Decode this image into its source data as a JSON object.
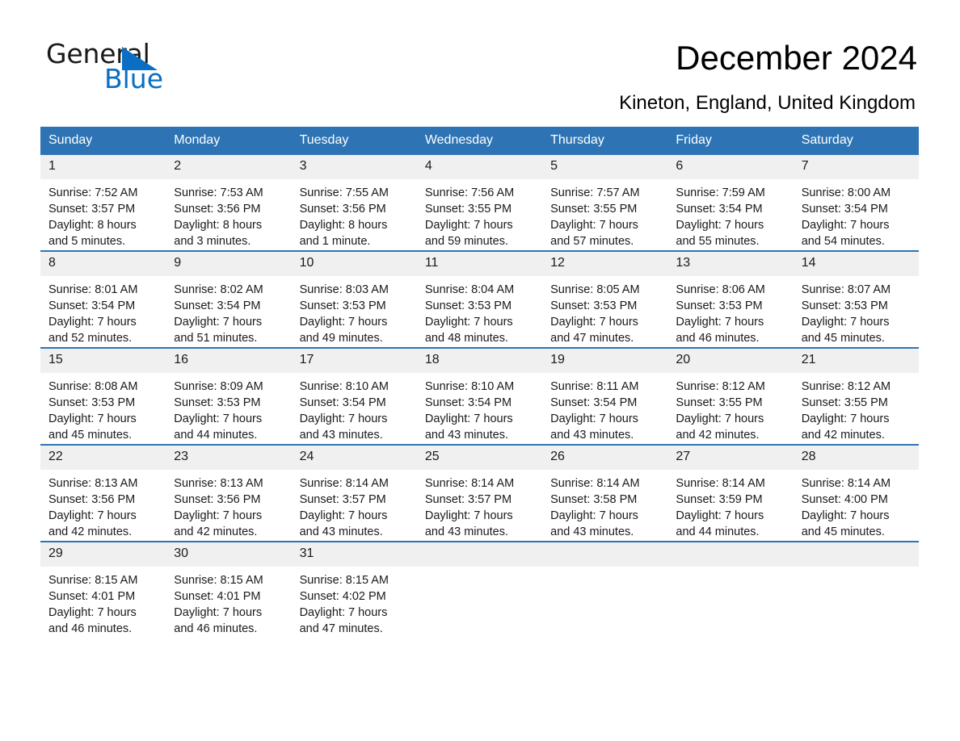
{
  "logo": {
    "word_one": "General",
    "word_two": "Blue",
    "triangle_color": "#0A6FC2",
    "text_color": "#1a1a1a"
  },
  "header": {
    "title": "December 2024",
    "location": "Kineton, England, United Kingdom"
  },
  "theme": {
    "header_blue": "#2E74B5",
    "row_band": "#F0F0F0",
    "text": "#1a1a1a"
  },
  "weekday_headers": [
    "Sunday",
    "Monday",
    "Tuesday",
    "Wednesday",
    "Thursday",
    "Friday",
    "Saturday"
  ],
  "weeks": [
    [
      {
        "day": "1",
        "sunrise": "Sunrise: 7:52 AM",
        "sunset": "Sunset: 3:57 PM",
        "daylight_line1": "Daylight: 8 hours",
        "daylight_line2": "and 5 minutes."
      },
      {
        "day": "2",
        "sunrise": "Sunrise: 7:53 AM",
        "sunset": "Sunset: 3:56 PM",
        "daylight_line1": "Daylight: 8 hours",
        "daylight_line2": "and 3 minutes."
      },
      {
        "day": "3",
        "sunrise": "Sunrise: 7:55 AM",
        "sunset": "Sunset: 3:56 PM",
        "daylight_line1": "Daylight: 8 hours",
        "daylight_line2": "and 1 minute."
      },
      {
        "day": "4",
        "sunrise": "Sunrise: 7:56 AM",
        "sunset": "Sunset: 3:55 PM",
        "daylight_line1": "Daylight: 7 hours",
        "daylight_line2": "and 59 minutes."
      },
      {
        "day": "5",
        "sunrise": "Sunrise: 7:57 AM",
        "sunset": "Sunset: 3:55 PM",
        "daylight_line1": "Daylight: 7 hours",
        "daylight_line2": "and 57 minutes."
      },
      {
        "day": "6",
        "sunrise": "Sunrise: 7:59 AM",
        "sunset": "Sunset: 3:54 PM",
        "daylight_line1": "Daylight: 7 hours",
        "daylight_line2": "and 55 minutes."
      },
      {
        "day": "7",
        "sunrise": "Sunrise: 8:00 AM",
        "sunset": "Sunset: 3:54 PM",
        "daylight_line1": "Daylight: 7 hours",
        "daylight_line2": "and 54 minutes."
      }
    ],
    [
      {
        "day": "8",
        "sunrise": "Sunrise: 8:01 AM",
        "sunset": "Sunset: 3:54 PM",
        "daylight_line1": "Daylight: 7 hours",
        "daylight_line2": "and 52 minutes."
      },
      {
        "day": "9",
        "sunrise": "Sunrise: 8:02 AM",
        "sunset": "Sunset: 3:54 PM",
        "daylight_line1": "Daylight: 7 hours",
        "daylight_line2": "and 51 minutes."
      },
      {
        "day": "10",
        "sunrise": "Sunrise: 8:03 AM",
        "sunset": "Sunset: 3:53 PM",
        "daylight_line1": "Daylight: 7 hours",
        "daylight_line2": "and 49 minutes."
      },
      {
        "day": "11",
        "sunrise": "Sunrise: 8:04 AM",
        "sunset": "Sunset: 3:53 PM",
        "daylight_line1": "Daylight: 7 hours",
        "daylight_line2": "and 48 minutes."
      },
      {
        "day": "12",
        "sunrise": "Sunrise: 8:05 AM",
        "sunset": "Sunset: 3:53 PM",
        "daylight_line1": "Daylight: 7 hours",
        "daylight_line2": "and 47 minutes."
      },
      {
        "day": "13",
        "sunrise": "Sunrise: 8:06 AM",
        "sunset": "Sunset: 3:53 PM",
        "daylight_line1": "Daylight: 7 hours",
        "daylight_line2": "and 46 minutes."
      },
      {
        "day": "14",
        "sunrise": "Sunrise: 8:07 AM",
        "sunset": "Sunset: 3:53 PM",
        "daylight_line1": "Daylight: 7 hours",
        "daylight_line2": "and 45 minutes."
      }
    ],
    [
      {
        "day": "15",
        "sunrise": "Sunrise: 8:08 AM",
        "sunset": "Sunset: 3:53 PM",
        "daylight_line1": "Daylight: 7 hours",
        "daylight_line2": "and 45 minutes."
      },
      {
        "day": "16",
        "sunrise": "Sunrise: 8:09 AM",
        "sunset": "Sunset: 3:53 PM",
        "daylight_line1": "Daylight: 7 hours",
        "daylight_line2": "and 44 minutes."
      },
      {
        "day": "17",
        "sunrise": "Sunrise: 8:10 AM",
        "sunset": "Sunset: 3:54 PM",
        "daylight_line1": "Daylight: 7 hours",
        "daylight_line2": "and 43 minutes."
      },
      {
        "day": "18",
        "sunrise": "Sunrise: 8:10 AM",
        "sunset": "Sunset: 3:54 PM",
        "daylight_line1": "Daylight: 7 hours",
        "daylight_line2": "and 43 minutes."
      },
      {
        "day": "19",
        "sunrise": "Sunrise: 8:11 AM",
        "sunset": "Sunset: 3:54 PM",
        "daylight_line1": "Daylight: 7 hours",
        "daylight_line2": "and 43 minutes."
      },
      {
        "day": "20",
        "sunrise": "Sunrise: 8:12 AM",
        "sunset": "Sunset: 3:55 PM",
        "daylight_line1": "Daylight: 7 hours",
        "daylight_line2": "and 42 minutes."
      },
      {
        "day": "21",
        "sunrise": "Sunrise: 8:12 AM",
        "sunset": "Sunset: 3:55 PM",
        "daylight_line1": "Daylight: 7 hours",
        "daylight_line2": "and 42 minutes."
      }
    ],
    [
      {
        "day": "22",
        "sunrise": "Sunrise: 8:13 AM",
        "sunset": "Sunset: 3:56 PM",
        "daylight_line1": "Daylight: 7 hours",
        "daylight_line2": "and 42 minutes."
      },
      {
        "day": "23",
        "sunrise": "Sunrise: 8:13 AM",
        "sunset": "Sunset: 3:56 PM",
        "daylight_line1": "Daylight: 7 hours",
        "daylight_line2": "and 42 minutes."
      },
      {
        "day": "24",
        "sunrise": "Sunrise: 8:14 AM",
        "sunset": "Sunset: 3:57 PM",
        "daylight_line1": "Daylight: 7 hours",
        "daylight_line2": "and 43 minutes."
      },
      {
        "day": "25",
        "sunrise": "Sunrise: 8:14 AM",
        "sunset": "Sunset: 3:57 PM",
        "daylight_line1": "Daylight: 7 hours",
        "daylight_line2": "and 43 minutes."
      },
      {
        "day": "26",
        "sunrise": "Sunrise: 8:14 AM",
        "sunset": "Sunset: 3:58 PM",
        "daylight_line1": "Daylight: 7 hours",
        "daylight_line2": "and 43 minutes."
      },
      {
        "day": "27",
        "sunrise": "Sunrise: 8:14 AM",
        "sunset": "Sunset: 3:59 PM",
        "daylight_line1": "Daylight: 7 hours",
        "daylight_line2": "and 44 minutes."
      },
      {
        "day": "28",
        "sunrise": "Sunrise: 8:14 AM",
        "sunset": "Sunset: 4:00 PM",
        "daylight_line1": "Daylight: 7 hours",
        "daylight_line2": "and 45 minutes."
      }
    ],
    [
      {
        "day": "29",
        "sunrise": "Sunrise: 8:15 AM",
        "sunset": "Sunset: 4:01 PM",
        "daylight_line1": "Daylight: 7 hours",
        "daylight_line2": "and 46 minutes."
      },
      {
        "day": "30",
        "sunrise": "Sunrise: 8:15 AM",
        "sunset": "Sunset: 4:01 PM",
        "daylight_line1": "Daylight: 7 hours",
        "daylight_line2": "and 46 minutes."
      },
      {
        "day": "31",
        "sunrise": "Sunrise: 8:15 AM",
        "sunset": "Sunset: 4:02 PM",
        "daylight_line1": "Daylight: 7 hours",
        "daylight_line2": "and 47 minutes."
      },
      {
        "day": "",
        "sunrise": "",
        "sunset": "",
        "daylight_line1": "",
        "daylight_line2": ""
      },
      {
        "day": "",
        "sunrise": "",
        "sunset": "",
        "daylight_line1": "",
        "daylight_line2": ""
      },
      {
        "day": "",
        "sunrise": "",
        "sunset": "",
        "daylight_line1": "",
        "daylight_line2": ""
      },
      {
        "day": "",
        "sunrise": "",
        "sunset": "",
        "daylight_line1": "",
        "daylight_line2": ""
      }
    ]
  ]
}
